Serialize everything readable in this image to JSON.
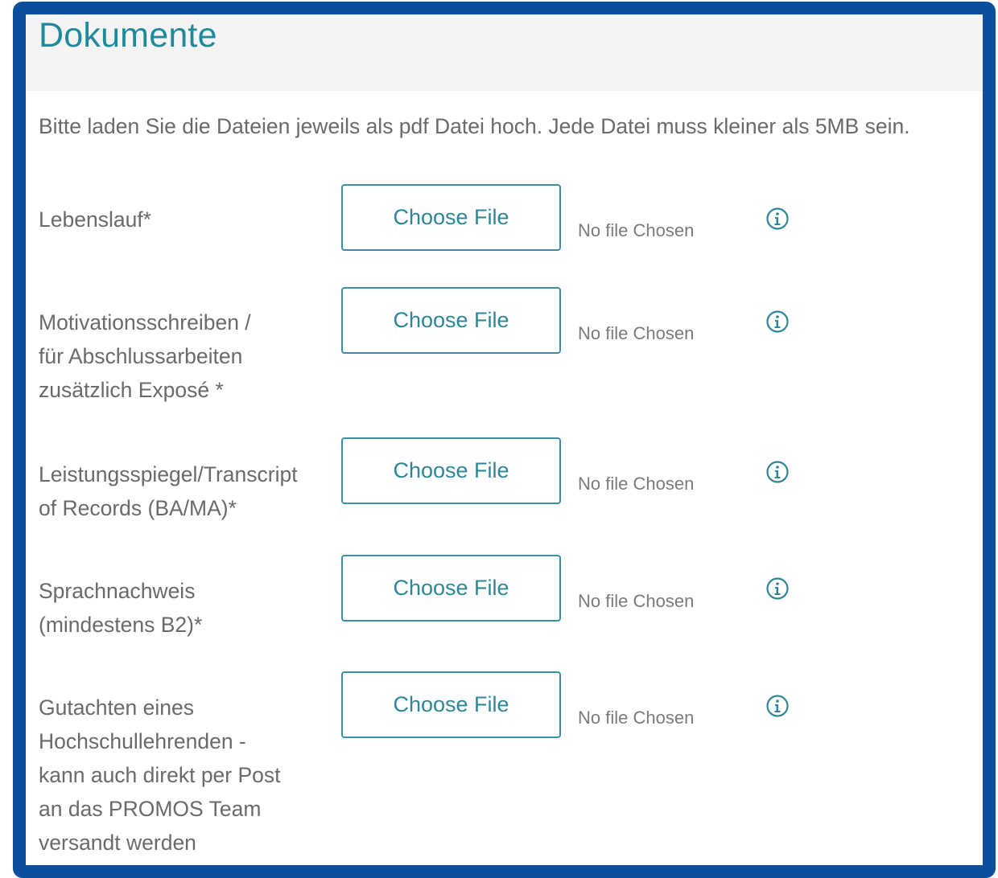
{
  "section": {
    "title": "Dokumente",
    "intro": "Bitte laden Sie die Dateien jeweils als pdf Datei hoch. Jede Datei muss kleiner als 5MB sein."
  },
  "upload_rows": [
    {
      "label_lines": [
        "Lebenslauf*"
      ],
      "button_label": "Choose File",
      "status": "No file Chosen",
      "info_icon": "info-circle-icon"
    },
    {
      "label_lines": [
        "Motivationsschreiben /",
        "für Abschlussarbeiten",
        "zusätzlich Exposé *"
      ],
      "button_label": "Choose File",
      "status": "No file Chosen",
      "info_icon": "info-circle-icon"
    },
    {
      "label_lines": [
        "Leistungsspiegel/Transcript",
        "of Records (BA/MA)*"
      ],
      "button_label": "Choose File",
      "status": "No file Chosen",
      "info_icon": "info-circle-icon"
    },
    {
      "label_lines": [
        "Sprachnachweis",
        "(mindestens B2)*"
      ],
      "button_label": "Choose File",
      "status": "No file Chosen",
      "info_icon": "info-circle-icon"
    },
    {
      "label_lines": [
        "Gutachten eines",
        "Hochschullehrenden -",
        "kann auch direkt per Post",
        "an das PROMOS Team",
        "versandt werden"
      ],
      "button_label": "Choose File",
      "status": "No file Chosen",
      "info_icon": "info-circle-icon"
    }
  ],
  "colors": {
    "frame_border": "#0b4f9c",
    "accent": "#1f8a9b",
    "text": "#6a6a6a",
    "header_bg": "#f4f4f4"
  }
}
